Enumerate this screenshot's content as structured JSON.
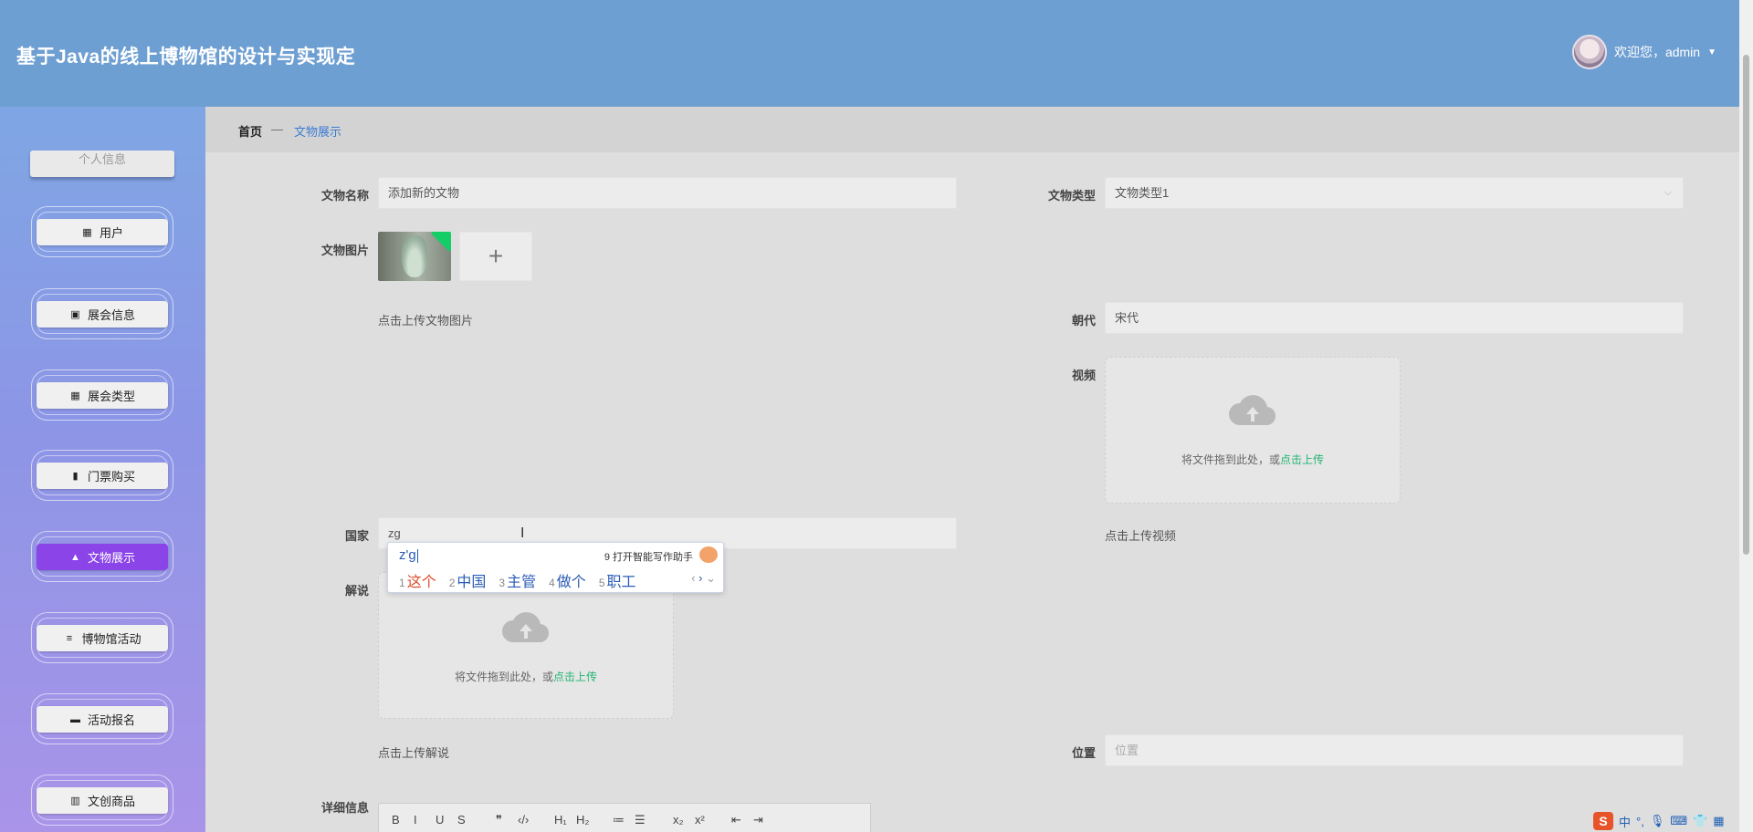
{
  "header": {
    "title": "基于Java的线上博物馆的设计与实现定",
    "welcome": "欢迎您，admin"
  },
  "sidebar": {
    "partial_item": "个人信息",
    "items": [
      {
        "label": "用户",
        "icon": "grid-icon"
      },
      {
        "label": "展会信息",
        "icon": "clipboard-icon"
      },
      {
        "label": "展会类型",
        "icon": "grid-icon"
      },
      {
        "label": "门票购买",
        "icon": "bar-chart-icon"
      },
      {
        "label": "文物展示",
        "icon": "user-icon",
        "active": true
      },
      {
        "label": "博物馆活动",
        "icon": "list-icon"
      },
      {
        "label": "活动报名",
        "icon": "briefcase-icon"
      },
      {
        "label": "文创商品",
        "icon": "book-icon"
      }
    ]
  },
  "breadcrumb": {
    "home": "首页",
    "separator": "—",
    "current": "文物展示"
  },
  "form": {
    "name_label": "文物名称",
    "name_value": "添加新的文物",
    "type_label": "文物类型",
    "type_value": "文物类型1",
    "image_label": "文物图片",
    "image_hint": "点击上传文物图片",
    "dynasty_label": "朝代",
    "dynasty_value": "宋代",
    "video_label": "视频",
    "video_hint": "点击上传视频",
    "country_label": "国家",
    "country_value": "zg",
    "commentary_label": "解说",
    "commentary_hint": "点击上传解说",
    "position_label": "位置",
    "position_placeholder": "位置",
    "detail_label": "详细信息",
    "upload_text": "将文件拖到此处，或",
    "upload_link": "点击上传"
  },
  "ime": {
    "input": "z'g",
    "assist": "9 打开智能写作助手",
    "candidates": [
      {
        "n": "1",
        "text": "这个"
      },
      {
        "n": "2",
        "text": "中国"
      },
      {
        "n": "3",
        "text": "主管"
      },
      {
        "n": "4",
        "text": "做个"
      },
      {
        "n": "5",
        "text": "职工"
      }
    ]
  },
  "editor_toolbar": [
    "B",
    "I",
    "U",
    "S",
    "❞",
    "‹/›",
    "H₁",
    "H₂",
    "≔",
    "☰",
    "x₂",
    "x²",
    "⇤",
    "⇥"
  ],
  "tray": {
    "lang": "中"
  },
  "colors": {
    "header": "#6e9fd2",
    "active_menu": "#8a44e8",
    "link": "#3a7bd5",
    "upload_link": "#22b573"
  }
}
